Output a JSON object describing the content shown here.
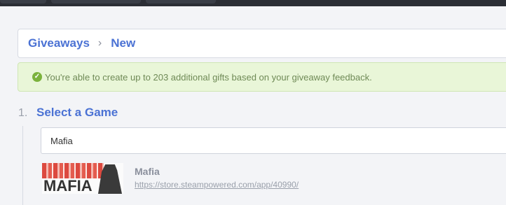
{
  "breadcrumb": {
    "root": "Giveaways",
    "separator": "›",
    "current": "New"
  },
  "notice": {
    "text": "You're able to create up to 203 additional gifts based on your giveaway feedback."
  },
  "step": {
    "number": "1.",
    "title": "Select a Game"
  },
  "search": {
    "value": "Mafia"
  },
  "result": {
    "image_text": "MAFIA",
    "name": "Mafia",
    "link": "https://store.steampowered.com/app/40990/"
  },
  "colors": {
    "accent": "#4b72d4",
    "success": "#7bb23c"
  }
}
